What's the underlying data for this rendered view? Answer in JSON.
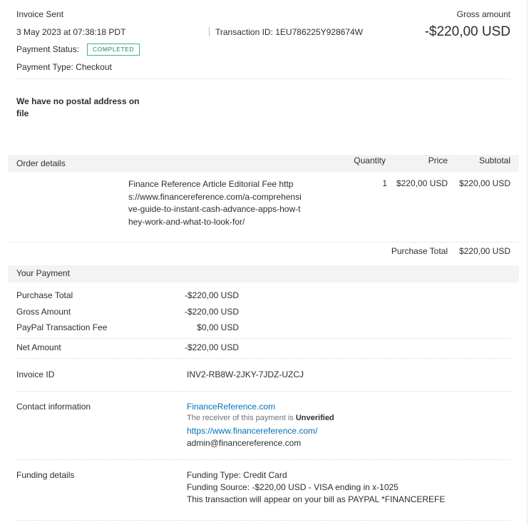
{
  "summary": {
    "title": "Invoice Sent",
    "datetime": "3 May 2023 at 07:38:18 PDT",
    "transaction_id": "Transaction ID: 1EU786225Y928674W",
    "gross_label": "Gross amount",
    "gross_value": "-$220,00 USD",
    "status_label": "Payment Status:",
    "status_value": "COMPLETED",
    "type_label": "Payment Type: Checkout",
    "postal_note": "We have no postal address on file"
  },
  "order": {
    "header": {
      "section": "Order details",
      "quantity": "Quantity",
      "price": "Price",
      "subtotal": "Subtotal"
    },
    "item": {
      "description": "Finance Reference Article Editorial Fee https://www.financereference.com/a-comprehensive-guide-to-instant-cash-advance-apps-how-they-work-and-what-to-look-for/",
      "quantity": "1",
      "price": "$220,00 USD",
      "subtotal": "$220,00 USD"
    },
    "purchase_total_label": "Purchase Total",
    "purchase_total_value": "$220,00 USD"
  },
  "payment": {
    "section": "Your Payment",
    "rows": [
      {
        "label": "Purchase Total",
        "value": "-$220,00 USD"
      },
      {
        "label": "Gross Amount",
        "value": "-$220,00 USD"
      },
      {
        "label": "PayPal Transaction Fee",
        "value": "$0,00 USD"
      }
    ],
    "net_label": "Net Amount",
    "net_value": "-$220,00 USD"
  },
  "invoice": {
    "label": "Invoice ID",
    "value": "INV2-RB8W-2JKY-7JDZ-UZCJ"
  },
  "contact": {
    "label": "Contact information",
    "name": "FinanceReference.com",
    "verification_prefix": "The receiver of this payment is",
    "verification_status": "Unverified",
    "website": "https://www.financereference.com/",
    "email": "admin@financereference.com"
  },
  "funding": {
    "label": "Funding details",
    "type": "Funding Type: Credit Card",
    "source": "Funding Source: -$220,00 USD - VISA ending in x-1025",
    "statement": "This transaction will appear on your bill as PAYPAL *FINANCEREFE"
  },
  "colors": {
    "link": "#0070ba",
    "badge_border": "#3bb39e",
    "band": "#f1f3f5"
  }
}
